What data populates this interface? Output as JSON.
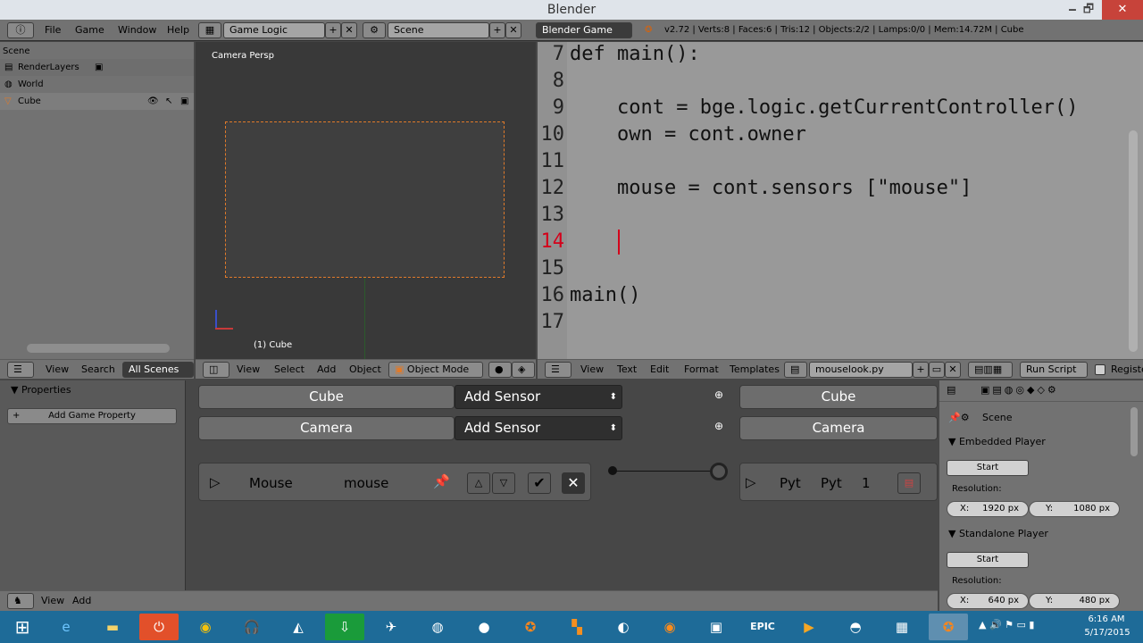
{
  "window": {
    "title": "Blender",
    "minimize": "🗕",
    "maximize": "🗗",
    "close": "✕"
  },
  "info": {
    "menus": [
      "File",
      "Game",
      "Window",
      "Help"
    ],
    "screen_layout": "Game Logic",
    "scene": "Scene",
    "engine": "Blender Game",
    "stats": "v2.72 | Verts:8 | Faces:6 | Tris:12 | Objects:2/2 | Lamps:0/0 | Mem:14.72M | Cube"
  },
  "outliner": {
    "scene": "Scene",
    "items": [
      "RenderLayers",
      "World",
      "Cube"
    ],
    "header": {
      "view": "View",
      "search": "Search",
      "display": "All Scenes"
    }
  },
  "viewport": {
    "label": "Camera Persp",
    "object": "(1) Cube",
    "header": {
      "view": "View",
      "select": "Select",
      "add": "Add",
      "object": "Object",
      "mode": "Object Mode"
    }
  },
  "text_editor": {
    "lines": [
      {
        "n": "7",
        "c": "def main():"
      },
      {
        "n": "8",
        "c": ""
      },
      {
        "n": "9",
        "c": "    cont = bge.logic.getCurrentController()"
      },
      {
        "n": "10",
        "c": "    own = cont.owner"
      },
      {
        "n": "11",
        "c": ""
      },
      {
        "n": "12",
        "c": "    mouse = cont.sensors [\"mouse\"]"
      },
      {
        "n": "13",
        "c": ""
      },
      {
        "n": "14",
        "c": ""
      },
      {
        "n": "15",
        "c": ""
      },
      {
        "n": "16",
        "c": "main()"
      },
      {
        "n": "17",
        "c": ""
      }
    ],
    "header": {
      "view": "View",
      "text": "Text",
      "edit": "Edit",
      "format": "Format",
      "templates": "Templates",
      "file": "mouselook.py",
      "run": "Run Script",
      "register": "Registe"
    }
  },
  "logic": {
    "properties": "Properties",
    "add_prop": "Add Game Property",
    "sensors": [
      {
        "obj": "Cube",
        "add": "Add Sensor"
      },
      {
        "obj": "Camera",
        "add": "Add Sensor"
      }
    ],
    "sensor_brick": {
      "type": "Mouse",
      "name": "mouse"
    },
    "controllers": [
      "Cube",
      "Camera"
    ],
    "controller_brick": {
      "type": "Pyt",
      "name": "Pyt",
      "num": "1"
    },
    "header": {
      "view": "View",
      "add": "Add"
    }
  },
  "props": {
    "scene": "Scene",
    "embedded": "Embedded Player",
    "standalone": "Standalone Player",
    "start": "Start",
    "resolution": "Resolution:",
    "emb_x": "1920 px",
    "emb_y": "1080 px",
    "sa_x": "640 px",
    "sa_y": "480 px",
    "x_label": "X:",
    "y_label": "Y:"
  },
  "taskbar": {
    "time": "6:16 AM",
    "date": "5/17/2015"
  },
  "colors": {
    "accent": "#e07a2a",
    "taskbar": "#1e6b98",
    "code_bg": "#999999"
  }
}
